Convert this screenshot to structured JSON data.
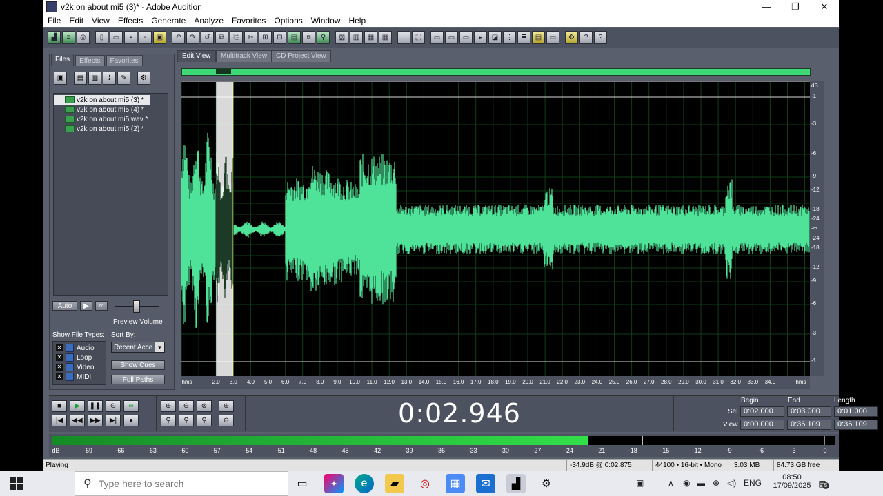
{
  "window": {
    "title": "v2k on about mi5 (3)* - Adobe Audition",
    "controls": [
      "—",
      "❐",
      "✕"
    ]
  },
  "menu": [
    "File",
    "Edit",
    "View",
    "Effects",
    "Generate",
    "Analyze",
    "Favorites",
    "Options",
    "Window",
    "Help"
  ],
  "left_panel": {
    "tabs": [
      "Files",
      "Effects",
      "Favorites"
    ],
    "files": [
      "v2k on about mi5 (3) *",
      "v2k on about mi5 (4) *",
      "v2k on about mi5.wav *",
      "v2k on about mi5 (2) *"
    ],
    "auto_label": "Auto",
    "preview_volume_label": "Preview Volume",
    "show_file_types_label": "Show File Types:",
    "file_types": [
      "Audio",
      "Loop",
      "Video",
      "MIDI"
    ],
    "sort_by_label": "Sort By:",
    "sort_value": "Recent Acce",
    "show_cues_label": "Show Cues",
    "full_paths_label": "Full Paths"
  },
  "view_tabs": [
    "Edit View",
    "Multitrack View",
    "CD Project View"
  ],
  "db_scale": {
    "header": "dB",
    "labels": [
      "-1",
      "-3",
      "-6",
      "-9",
      "-12",
      "-18",
      "-24",
      "-∞",
      "-24",
      "-18",
      "-12",
      "-9",
      "-6",
      "-3",
      "-1"
    ]
  },
  "time_ruler": {
    "left_unit": "hms",
    "right_unit": "hms",
    "labels": [
      "2.0",
      "3.0",
      "4.0",
      "5.0",
      "6.0",
      "7.0",
      "8.0",
      "9.0",
      "10.0",
      "11.0",
      "12.0",
      "13.0",
      "14.0",
      "15.0",
      "16.0",
      "17.0",
      "18.0",
      "19.0",
      "20.0",
      "21.0",
      "22.0",
      "23.0",
      "24.0",
      "25.0",
      "26.0",
      "27.0",
      "28.0",
      "29.0",
      "30.0",
      "31.0",
      "32.0",
      "33.0",
      "34.0"
    ]
  },
  "transport": {
    "time_display": "0:02.946"
  },
  "selection": {
    "begin_label": "Begin",
    "end_label": "End",
    "length_label": "Length",
    "sel_label": "Sel",
    "view_label": "View",
    "sel_begin": "0:02.000",
    "sel_end": "0:03.000",
    "sel_length": "0:01.000",
    "view_begin": "0:00.000",
    "view_end": "0:36.109",
    "view_length": "0:36.109"
  },
  "level_meter": {
    "labels": [
      "dB",
      "-69",
      "-66",
      "-63",
      "-60",
      "-57",
      "-54",
      "-51",
      "-48",
      "-45",
      "-42",
      "-39",
      "-36",
      "-33",
      "-30",
      "-27",
      "-24",
      "-21",
      "-18",
      "-15",
      "-12",
      "-9",
      "-6",
      "-3",
      "0"
    ],
    "fill_fraction": 0.685
  },
  "status": {
    "state": "Playing",
    "cursor": "-34.9dB @  0:02.875",
    "format": "44100 • 16-bit • Mono",
    "size": "3.03 MB",
    "free": "84.73 GB free"
  },
  "taskbar": {
    "search_placeholder": "Type here to search",
    "lang": "ENG",
    "time": "08:50",
    "date": "17/09/2025",
    "notif_count": "5"
  },
  "colors": {
    "waveform": "#4fe39a",
    "panel": "#4d5260",
    "grid": "#0f3d18"
  }
}
